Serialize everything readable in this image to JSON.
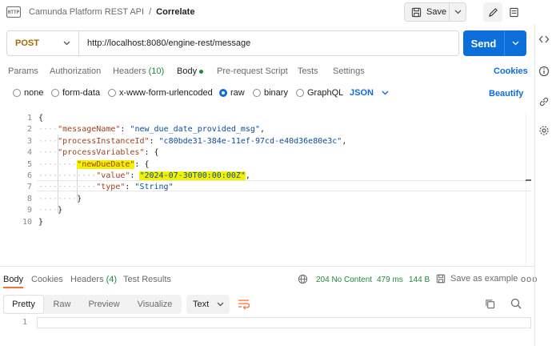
{
  "topbar": {
    "badge": "HTTP",
    "collection": "Camunda Platform REST API",
    "separator": "/",
    "request_name": "Correlate",
    "save_label": "Save"
  },
  "request": {
    "method": "POST",
    "url": "http://localhost:8080/engine-rest/message",
    "send_label": "Send"
  },
  "tabs": [
    {
      "label": "Params"
    },
    {
      "label": "Authorization"
    },
    {
      "label": "Headers",
      "count": "(10)"
    },
    {
      "label": "Body"
    },
    {
      "label": "Pre-request Script"
    },
    {
      "label": "Tests"
    },
    {
      "label": "Settings"
    }
  ],
  "cookies_label": "Cookies",
  "body_types": [
    "none",
    "form-data",
    "x-www-form-urlencoded",
    "raw",
    "binary",
    "GraphQL"
  ],
  "selected_body_type": "raw",
  "format_label": "JSON",
  "beautify_label": "Beautify",
  "editor": {
    "line_numbers": [
      "1",
      "2",
      "3",
      "4",
      "5",
      "6",
      "7",
      "8",
      "9",
      "10"
    ],
    "lines": [
      {
        "tokens": [
          {
            "t": "{",
            "c": "p"
          }
        ]
      },
      {
        "tokens": [
          {
            "t": "····",
            "c": "ws"
          },
          {
            "t": "\"messageName\"",
            "c": "key"
          },
          {
            "t": ": ",
            "c": "p"
          },
          {
            "t": "\"new_due_date_provided_msg\"",
            "c": "str"
          },
          {
            "t": ",",
            "c": "p"
          }
        ]
      },
      {
        "tokens": [
          {
            "t": "····",
            "c": "ws"
          },
          {
            "t": "\"processInstanceId\"",
            "c": "key"
          },
          {
            "t": ": ",
            "c": "p"
          },
          {
            "t": "\"c80bde31-384e-11ef-97cd-e40d36e80e3c\"",
            "c": "str"
          },
          {
            "t": ",",
            "c": "p"
          }
        ]
      },
      {
        "tokens": [
          {
            "t": "····",
            "c": "ws"
          },
          {
            "t": "\"processVariables\"",
            "c": "key"
          },
          {
            "t": ": {",
            "c": "p"
          }
        ]
      },
      {
        "tokens": [
          {
            "t": "········",
            "c": "ws"
          },
          {
            "t": "\"newDueDate\"",
            "c": "key",
            "h": true
          },
          {
            "t": ": {",
            "c": "p"
          }
        ]
      },
      {
        "tokens": [
          {
            "t": "············",
            "c": "ws"
          },
          {
            "t": "\"value\"",
            "c": "key"
          },
          {
            "t": ": ",
            "c": "p"
          },
          {
            "t": "\"2024-07-30T00:00:00Z\"",
            "c": "str",
            "h": true
          },
          {
            "t": ",",
            "c": "p"
          }
        ]
      },
      {
        "tokens": [
          {
            "t": "············",
            "c": "ws"
          },
          {
            "t": "\"type\"",
            "c": "key"
          },
          {
            "t": ": ",
            "c": "p"
          },
          {
            "t": "\"String\"",
            "c": "str"
          }
        ]
      },
      {
        "tokens": [
          {
            "t": "········",
            "c": "ws"
          },
          {
            "t": "}",
            "c": "p"
          }
        ]
      },
      {
        "tokens": [
          {
            "t": "····",
            "c": "ws"
          },
          {
            "t": "}",
            "c": "p"
          }
        ]
      },
      {
        "tokens": [
          {
            "t": "}",
            "c": "p"
          }
        ]
      }
    ]
  },
  "response": {
    "tabs": [
      {
        "label": "Body"
      },
      {
        "label": "Cookies"
      },
      {
        "label": "Headers",
        "count": "(4)"
      },
      {
        "label": "Test Results"
      }
    ],
    "status": "204 No Content",
    "time": "479 ms",
    "size": "144 B",
    "save_example_label": "Save as example",
    "more_label": "ooo",
    "view_modes": [
      "Pretty",
      "Raw",
      "Preview",
      "Visualize"
    ],
    "selected_view": "Pretty",
    "format_label": "Text",
    "line_number": "1"
  },
  "colors": {
    "accent": "#0b6ed9",
    "method_post": "#a16b00",
    "status_ok": "#1f8a3c",
    "highlight": "#f3f000",
    "json_key": "#a1421c",
    "json_string": "#0a4c9c"
  }
}
